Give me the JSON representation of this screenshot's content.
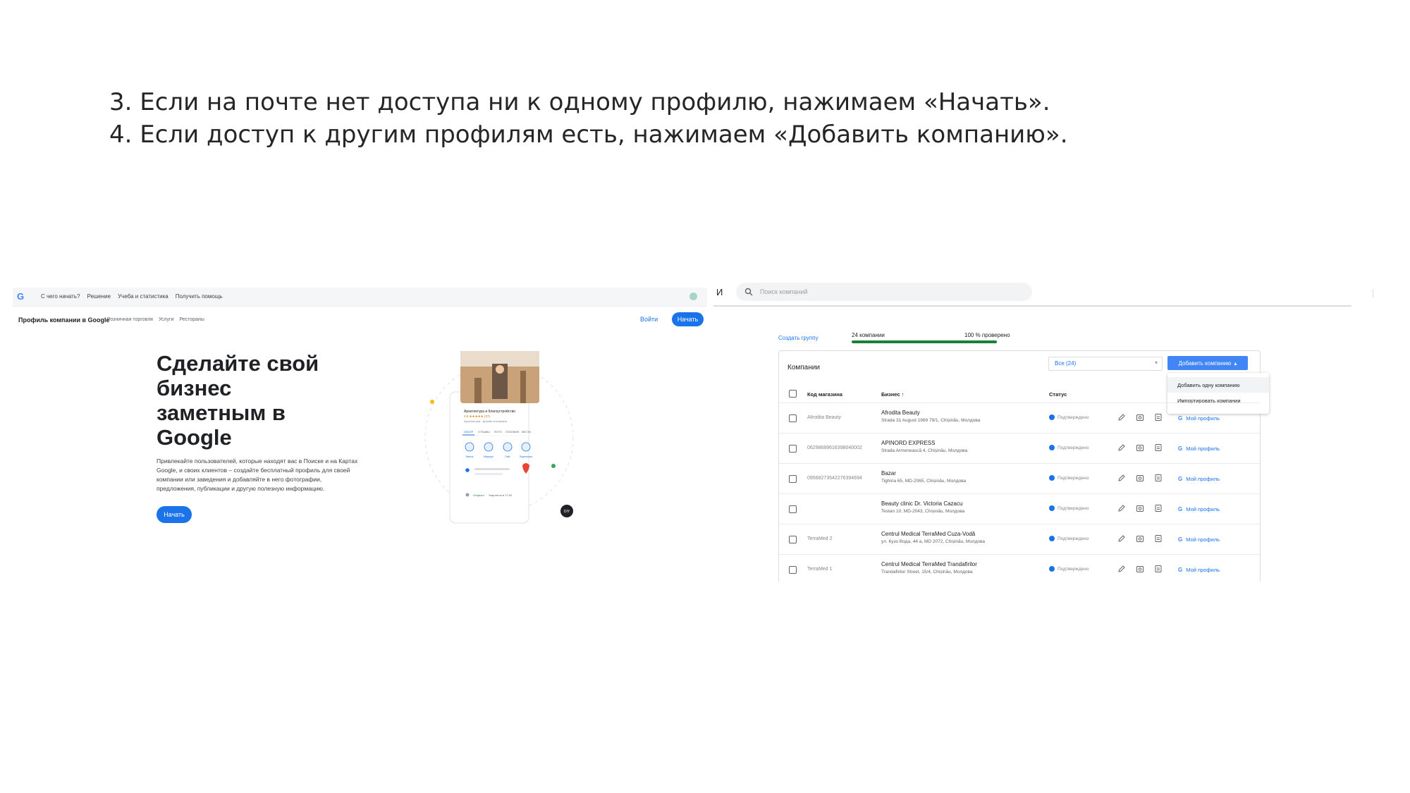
{
  "instructions": {
    "line3": "3. Если на почте нет доступа ни к одному профилю, нажимаем «Начать».",
    "line4": "4. Если доступ к другим профилям есть, нажимаем «Добавить компанию»."
  },
  "left": {
    "logo": "G",
    "topnav": [
      "С чего начать?",
      "Решение",
      "Учеба и статистика",
      "Получить помощь"
    ],
    "brand": "Профиль компании в Google",
    "subnav": [
      "Розничная торговля",
      "Услуги",
      "Рестораны"
    ],
    "signin": "Войти",
    "start_top": "Начать",
    "hero_title": "Сделайте свой бизнес заметным в Google",
    "hero_desc": "Привлекайте пользователей, которые находят вас в Поиске и на Картах Google, и своих клиентов – создайте бесплатный профиль для своей компании или заведения и добавляйте в него фотографии, предложения, публикации и другую полезную информацию.",
    "start_main": "Начать",
    "card_name": "Архитектура и благоустройство",
    "card_rating": "4,8 ★★★★★ (37)",
    "card_sub": "Архитектура · Дизайн интерьера",
    "card_tabs": [
      "ОБЗОР",
      "ОТЗЫВЫ",
      "ФОТО",
      "ПОХОЖИЕ",
      "МЕСТА"
    ],
    "card_actions": [
      "Звонок",
      "Маршрут",
      "Сайт",
      "Поделиться"
    ],
    "card_hours_open": "Открыто",
    "card_hours_close": "Закроется в 17:00",
    "card_badge": "DIY"
  },
  "right": {
    "top_letter": "И",
    "search_placeholder": "Поиск компаний",
    "create_group": "Создать группу",
    "count_label": "24 компании",
    "verified_label": "100 % проверено",
    "verified_percent": 100,
    "card_title": "Компании",
    "filter_value": "Все (24)",
    "add_company": "Добавить компанию",
    "dropdown": [
      "Добавить одну компанию",
      "Импортировать компании"
    ],
    "headers": {
      "code": "Код магазина",
      "business": "Бизнес",
      "status": "Статус"
    },
    "rows": [
      {
        "code": "Afrodita Beauty",
        "name": "Afrodita Beauty",
        "address": "Strada 31 August 1989 79/1, Chișinău, Молдова",
        "status": "Подтверждено",
        "profile": "Мой профиль"
      },
      {
        "code": "06298689616398040002",
        "name": "APINORD EXPRESS",
        "address": "Strada Armenească 4, Chișinău, Молдова",
        "status": "Подтверждено",
        "profile": "Мой профиль"
      },
      {
        "code": "09568273542276394694",
        "name": "Bazar",
        "address": "Tighina 65, MD-2065, Chișinău, Молдова",
        "status": "Подтверждено",
        "profile": "Мой профиль"
      },
      {
        "code": "",
        "name": "Beauty clinic Dr. Victoria Cazacu",
        "address": "Testan 10, MD-2043, Chișinău, Молдова",
        "status": "Подтверждено",
        "profile": "Мой профиль"
      },
      {
        "code": "TerraMed 2",
        "name": "Centrul Medical TerraMed Cuza-Vodă",
        "address": "ул. Кузо Вода, 44 а, MD 2072, Chișinău, Молдова",
        "status": "Подтверждено",
        "profile": "Мой профиль"
      },
      {
        "code": "TerraMed 1",
        "name": "Centrul Medical TerraMed Trandafirilor",
        "address": "Trandafirilor Street, 15/4, Chișinău, Молдова",
        "status": "Подтверждено",
        "profile": "Мой профиль"
      }
    ]
  },
  "colors": {
    "primary": "#1a73e8",
    "verified_green": "#188038"
  }
}
